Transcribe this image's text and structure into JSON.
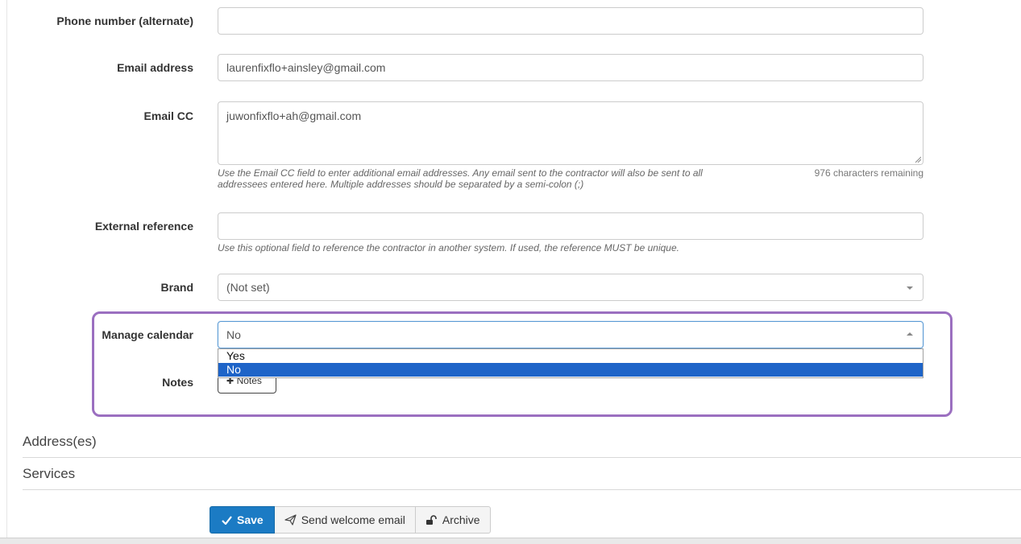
{
  "form": {
    "phone_alternate": {
      "label": "Phone number (alternate)",
      "value": ""
    },
    "email": {
      "label": "Email address",
      "value": "laurenfixflo+ainsley@gmail.com"
    },
    "email_cc": {
      "label": "Email CC",
      "value": "juwonfixflo+ah@gmail.com",
      "help_line1": "Use the Email CC field to enter additional email addresses. Any email sent to the contractor will also be sent to all",
      "help_line2": "addressees entered here. Multiple addresses should be separated by a semi-colon (;)",
      "counter": "976 characters remaining"
    },
    "external_reference": {
      "label": "External reference",
      "value": "",
      "help": "Use this optional field to reference the contractor in another system. If used, the reference MUST be unique."
    },
    "brand": {
      "label": "Brand",
      "value": "(Not set)"
    },
    "manage_calendar": {
      "label": "Manage calendar",
      "value": "No",
      "options": [
        "Yes",
        "No"
      ],
      "selected_index": 1
    },
    "notes": {
      "label": "Notes",
      "button_label": "Notes"
    }
  },
  "sections": {
    "addresses": "Address(es)",
    "services": "Services"
  },
  "actions": {
    "save": "Save",
    "send_welcome": "Send welcome email",
    "archive": "Archive"
  },
  "colors": {
    "primary": "#1b7bc4",
    "highlight": "#9b6fc0",
    "selected_option": "#1e64c8"
  }
}
